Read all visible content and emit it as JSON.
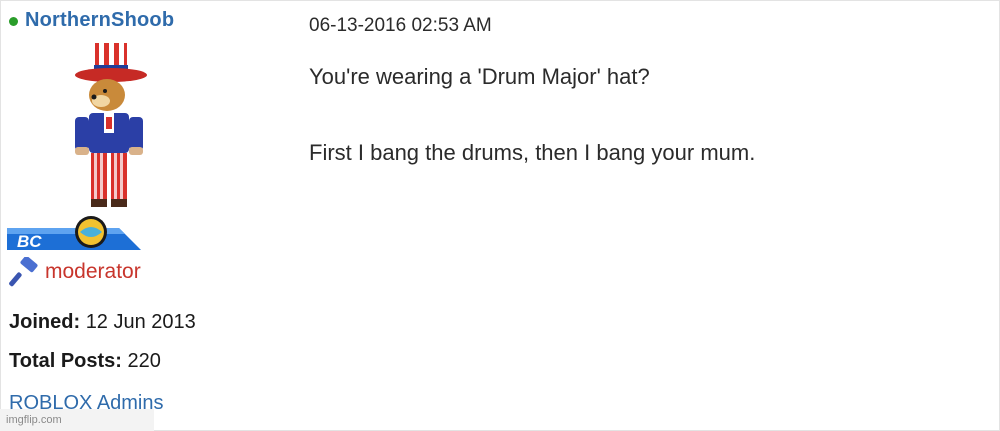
{
  "author": {
    "username": "NorthernShoob",
    "online_status": "online",
    "membership_badge": "BC",
    "role_icon": "gavel-icon",
    "role": "moderator",
    "joined_label": "Joined:",
    "joined_value": "12 Jun 2013",
    "posts_label": "Total Posts:",
    "posts_value": "220",
    "group": "ROBLOX Admins"
  },
  "post": {
    "timestamp": "06-13-2016 02:53 AM",
    "lines": [
      "You're wearing a 'Drum Major' hat?",
      "First I bang the drums, then I bang your mum."
    ]
  },
  "watermark": "imgflip.com",
  "colors": {
    "link": "#2f6bab",
    "role": "#c8352c",
    "online": "#2a9d2a",
    "badge_blue": "#1d6fd6"
  }
}
